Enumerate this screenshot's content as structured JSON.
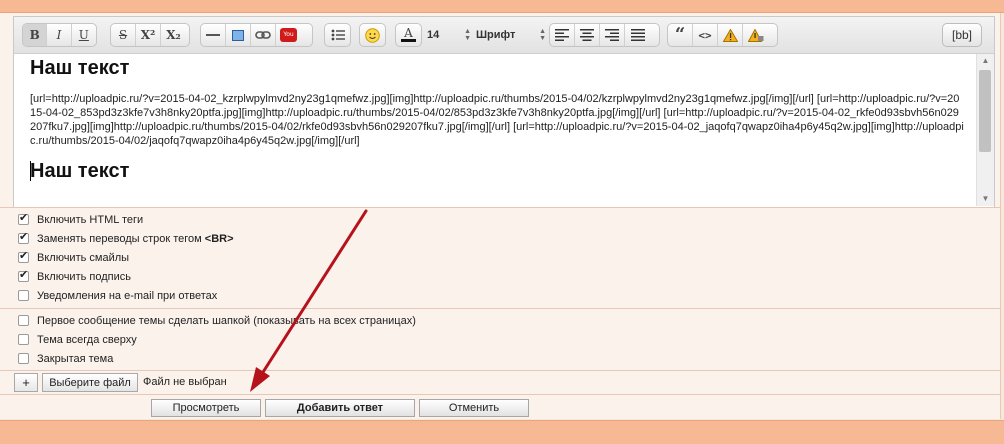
{
  "toolbar": {
    "bold": "B",
    "italic": "I",
    "underline": "U",
    "strike": "S",
    "superscript": "X²",
    "subscript": "X₂",
    "font_size": "14",
    "font_name": "Шрифт",
    "quote": "“",
    "code": "<>",
    "bb_label": "[bb]"
  },
  "editor": {
    "heading1": "Наш текст",
    "code_text": "[url=http://uploadpic.ru/?v=2015-04-02_kzrplwpylmvd2ny23g1qmefwz.jpg][img]http://uploadpic.ru/thumbs/2015-04/02/kzrplwpylmvd2ny23g1qmefwz.jpg[/img][/url] [url=http://uploadpic.ru/?v=2015-04-02_853pd3z3kfe7v3h8nky20ptfa.jpg][img]http://uploadpic.ru/thumbs/2015-04/02/853pd3z3kfe7v3h8nky20ptfa.jpg[/img][/url] [url=http://uploadpic.ru/?v=2015-04-02_rkfe0d93sbvh56n029207fku7.jpg][img]http://uploadpic.ru/thumbs/2015-04/02/rkfe0d93sbvh56n029207fku7.jpg[/img][/url] [url=http://uploadpic.ru/?v=2015-04-02_jaqofq7qwapz0iha4p6y45q2w.jpg][img]http://uploadpic.ru/thumbs/2015-04/02/jaqofq7qwapz0iha4p6y45q2w.jpg[/img][/url]",
    "heading2": "Наш текст"
  },
  "options": [
    {
      "label": "Включить HTML теги",
      "checked": true
    },
    {
      "label": "Заменять переводы строк тегом",
      "bold_suffix": "<BR>",
      "checked": true
    },
    {
      "label": "Включить смайлы",
      "checked": true
    },
    {
      "label": "Включить подпись",
      "checked": true
    },
    {
      "label": "Уведомления на e-mail при ответах",
      "checked": false
    }
  ],
  "topic_options": [
    {
      "label": "Первое сообщение темы сделать шапкой (показывать на всех страницах)",
      "checked": false
    },
    {
      "label": "Тема всегда сверху",
      "checked": false
    },
    {
      "label": "Закрытая тема",
      "checked": false
    }
  ],
  "file": {
    "plus_label": "+",
    "choose_label": "Выберите файл",
    "status": "Файл не выбран"
  },
  "actions": {
    "preview": "Просмотреть",
    "submit": "Добавить ответ",
    "cancel": "Отменить"
  },
  "colors": {
    "accent_band": "#f6b994",
    "frame_bg": "#fbf2ec",
    "arrow": "#b5121b"
  }
}
